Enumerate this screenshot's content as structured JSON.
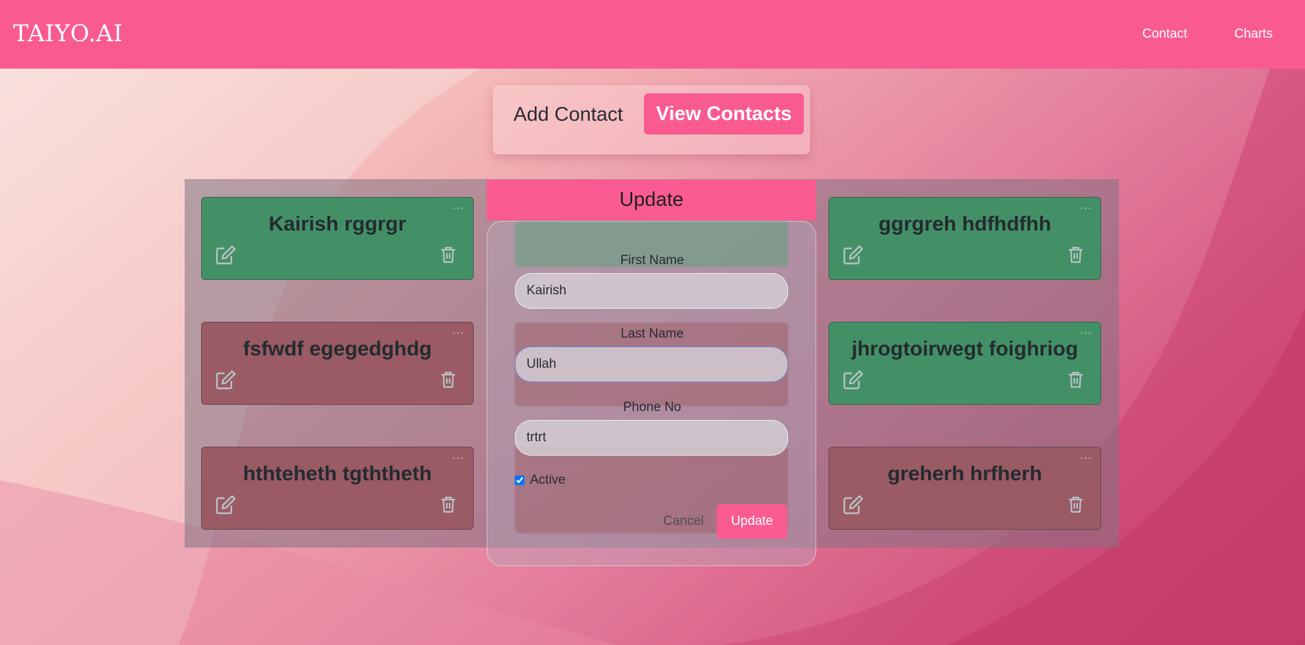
{
  "header": {
    "logo": "TAIYO.AI",
    "nav": [
      {
        "label": "Contact"
      },
      {
        "label": "Charts"
      }
    ]
  },
  "toggle": {
    "add_label": "Add Contact",
    "view_label": "View Contacts"
  },
  "cards": [
    {
      "name": "Kairish rggrgr",
      "status": "active",
      "more": "···"
    },
    {
      "name": "fsfwdf egegedghdg",
      "status": "inactive",
      "more": "···"
    },
    {
      "name": "hthteheth tgththeth",
      "status": "inactive",
      "more": "···"
    },
    {
      "name": "ggrgreh hdfhdfhh",
      "status": "active",
      "more": "···"
    },
    {
      "name": "jhrogtoirwegt foighriog",
      "status": "active",
      "more": "···"
    },
    {
      "name": "greherh hrfherh",
      "status": "inactive",
      "more": "···"
    }
  ],
  "modal": {
    "title": "Update",
    "first_name_label": "First Name",
    "first_name_value": "Kairish",
    "last_name_label": "Last Name",
    "last_name_value": "Ullah",
    "phone_label": "Phone No",
    "phone_value": "trtrt",
    "active_label": "Active",
    "active_checked": true,
    "cancel_label": "Cancel",
    "update_label": "Update"
  },
  "colors": {
    "accent": "#f95b91",
    "active_card": "#449066",
    "inactive_card": "#9a5b64"
  }
}
